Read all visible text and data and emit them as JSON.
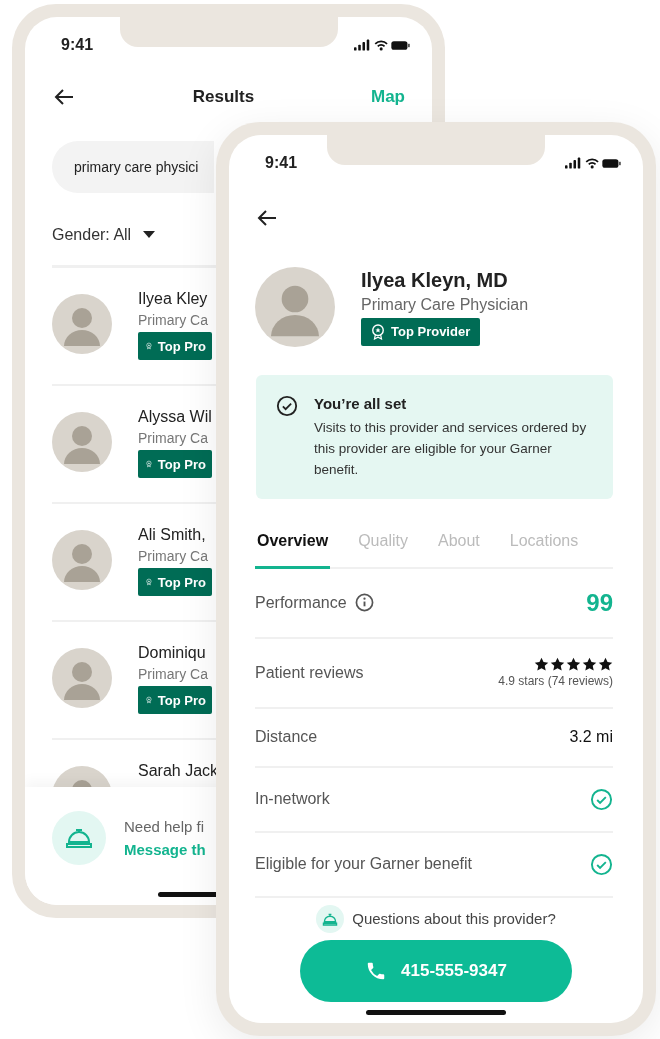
{
  "back_screen": {
    "status_time": "9:41",
    "title": "Results",
    "map_link": "Map",
    "search": {
      "value": "primary care physici"
    },
    "filter": "Gender: All",
    "providers": [
      {
        "name": "Ilyea Kley",
        "specialty": "Primary Ca",
        "badge": "Top Pro"
      },
      {
        "name": "Alyssa Wil",
        "specialty": "Primary Ca",
        "badge": "Top Pro"
      },
      {
        "name": "Ali Smith,",
        "specialty": "Primary Ca",
        "badge": "Top Pro"
      },
      {
        "name": "Dominiqu",
        "specialty": "Primary Ca",
        "badge": "Top Pro"
      },
      {
        "name": "Sarah Jack"
      }
    ],
    "help": {
      "text": "Need help fi",
      "link": "Message th"
    }
  },
  "front_screen": {
    "status_time": "9:41",
    "provider": {
      "name": "Ilyea Kleyn, MD",
      "specialty": "Primary Care Physician",
      "badge": "Top Provider"
    },
    "notice": {
      "title": "You’re all set",
      "body": "Visits to this provider and services ordered by this provider are eligible for your Garner benefit."
    },
    "tabs": [
      {
        "label": "Overview",
        "selected": true
      },
      {
        "label": "Quality",
        "selected": false
      },
      {
        "label": "About",
        "selected": false
      },
      {
        "label": "Locations",
        "selected": false
      }
    ],
    "details": [
      {
        "kind": "score",
        "label": "Performance",
        "value": "99"
      },
      {
        "kind": "reviews",
        "label": "Patient reviews",
        "stars": 5,
        "value": "4.9 stars (74 reviews)"
      },
      {
        "kind": "text",
        "label": "Distance",
        "value": "3.2 mi"
      },
      {
        "kind": "check",
        "label": "In-network",
        "checked": true
      },
      {
        "kind": "check",
        "label": "Eligible for your Garner benefit",
        "checked": true
      }
    ],
    "question": "Questions about this provider?",
    "call_button": "415-555-9347"
  }
}
